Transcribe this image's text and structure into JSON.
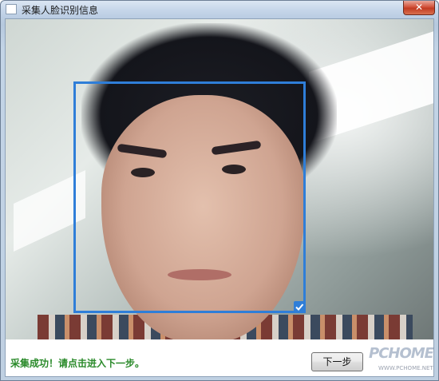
{
  "window": {
    "title": "采集人脸识别信息",
    "close_label": "✕"
  },
  "camera": {
    "face_detected": true,
    "status_icon": "check-icon"
  },
  "footer": {
    "status_message": "采集成功！请点击进入下一步。",
    "status_color": "#2a8a2a",
    "next_button_label": "下一步"
  },
  "watermark": {
    "logo_text": "PCHOME",
    "url_text": "WWW.PCHOME.NET"
  },
  "colors": {
    "face_box": "#2f7ed8",
    "close_button": "#c23b22"
  }
}
